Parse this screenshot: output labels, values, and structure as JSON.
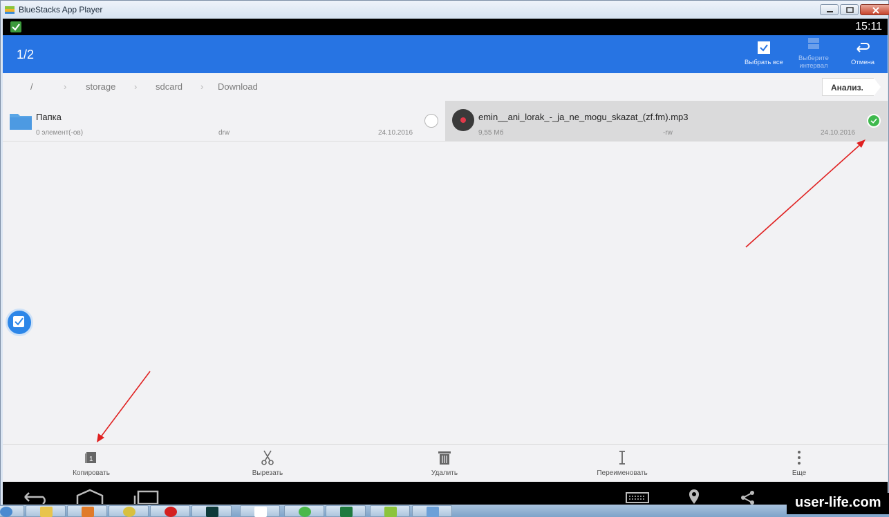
{
  "window": {
    "title": "BlueStacks App Player",
    "controls": [
      "minimize-icon",
      "maximize-icon",
      "close-icon"
    ]
  },
  "status": {
    "time": "15:11"
  },
  "appbar": {
    "selection_count": "1/2",
    "actions": [
      {
        "label": "Выбрать все",
        "icon": "select-all-icon"
      },
      {
        "label": "Выберите интервал",
        "icon": "select-interval-icon"
      },
      {
        "label": "Отмена",
        "icon": "cancel-back-icon"
      }
    ]
  },
  "breadcrumb": [
    "/",
    "storage",
    "sdcard",
    "Download"
  ],
  "analyze_label": "Анализ.",
  "items": [
    {
      "name": "Папка",
      "count": "0 элемент(-ов)",
      "perm": "drw",
      "date": "24.10.2016",
      "selected": false,
      "icon": "folder-icon"
    },
    {
      "name": "emin__ani_lorak_-_ja_ne_mogu_skazat_(zf.fm).mp3",
      "size": "9,55 Мб",
      "perm": "-rw",
      "date": "24.10.2016",
      "selected": true,
      "icon": "music-disc-icon"
    }
  ],
  "toolbar": [
    {
      "label": "Копировать",
      "icon": "copy-icon"
    },
    {
      "label": "Вырезать",
      "icon": "scissors-icon"
    },
    {
      "label": "Удалить",
      "icon": "trash-icon"
    },
    {
      "label": "Переименовать",
      "icon": "rename-icon"
    },
    {
      "label": "Еще",
      "icon": "more-vert-icon"
    }
  ],
  "watermark": "user-life.com",
  "colors": {
    "accent": "#2774e3",
    "selected_row": "#dadadb",
    "check_green": "#3eb94d",
    "annotation_arrow": "#e02020"
  }
}
